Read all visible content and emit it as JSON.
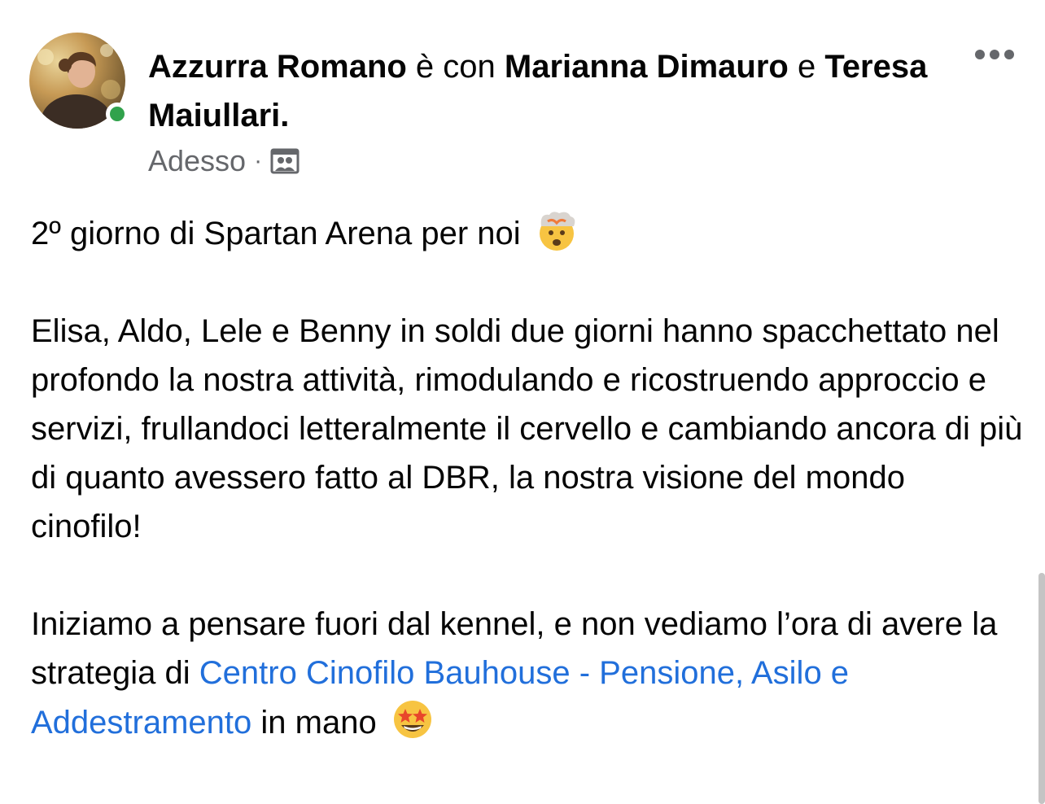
{
  "post": {
    "author": "Azzurra Romano",
    "with_text": " è con ",
    "tagged_1": "Marianna Dimauro",
    "and_text": " e ",
    "tagged_2": "Teresa Maiullari",
    "period": ".",
    "time": "Adesso",
    "separator": "·",
    "audience_icon": "friends-icon",
    "online": true,
    "body": {
      "line1": "2º giorno di Spartan Arena per noi",
      "line1_emoji": "exploding-head-emoji",
      "paragraph2": "Elisa, Aldo, Lele e Benny in soldi due giorni hanno spacchettato nel profondo la nostra attività, rimodulando e ricostruendo approccio e servizi, frullandoci letteralmente il cervello e cambiando ancora di più di quanto avessero fatto al DBR, la nostra visione del mondo cinofilo!",
      "paragraph3_start": "Iniziamo a pensare fuori dal kennel, e non vediamo l’ora di avere la strategia di ",
      "paragraph3_link": "Centro Cinofilo Bauhouse - Pensione, Asilo e Addestramento",
      "paragraph3_end": " in mano",
      "paragraph3_emoji": "star-struck-emoji"
    }
  },
  "colors": {
    "text": "#050505",
    "secondary": "#65676b",
    "link": "#216fdb",
    "online": "#31a24c"
  }
}
